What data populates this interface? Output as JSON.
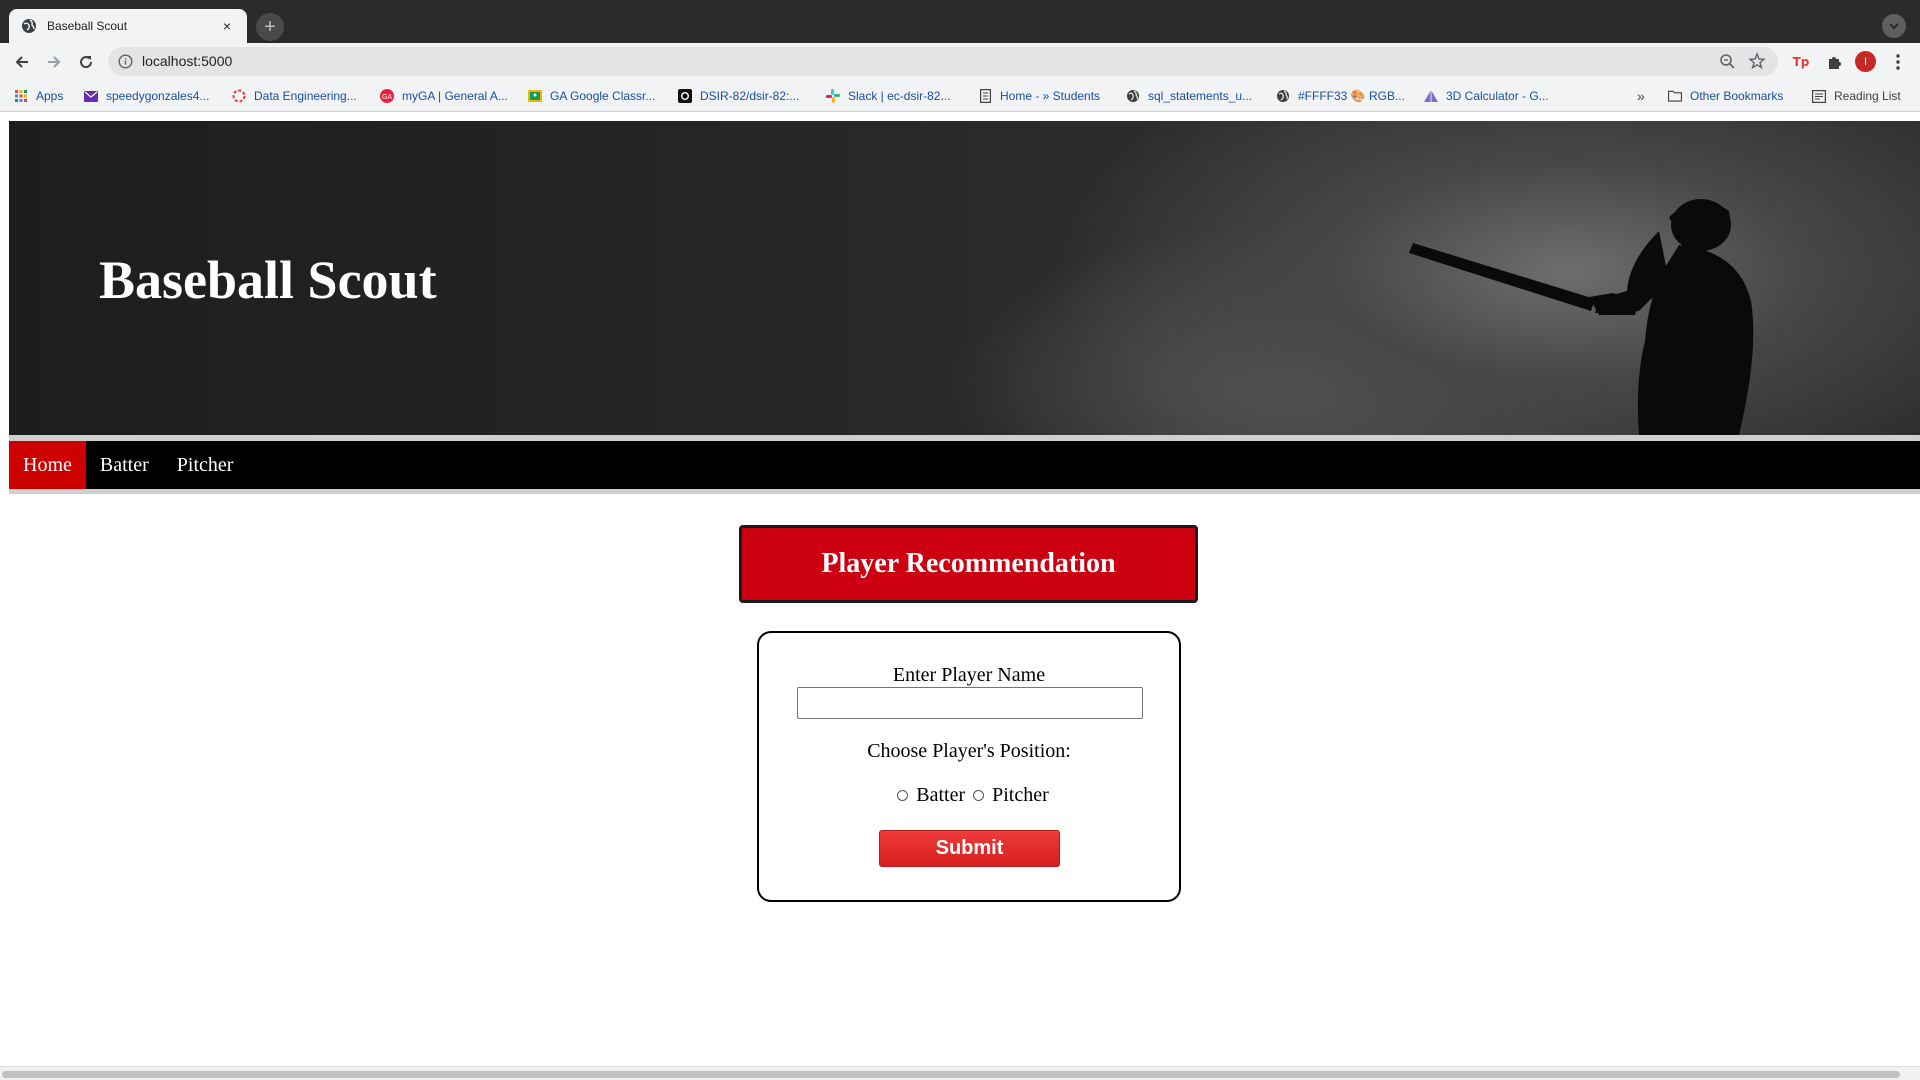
{
  "browser": {
    "tab_title": "Baseball Scout",
    "tab_close": "×",
    "new_tab": "+",
    "url": "localhost:5000",
    "profile_initial": "I",
    "ext_tp": "Tp",
    "bookmarks": [
      {
        "label": "Apps",
        "icon": "apps-grid-icon"
      },
      {
        "label": "speedygonzales4...",
        "icon": "mail-icon"
      },
      {
        "label": "Data Engineering...",
        "icon": "circle-icon"
      },
      {
        "label": "myGA | General A...",
        "icon": "ga-icon"
      },
      {
        "label": "GA Google Classr...",
        "icon": "classroom-icon"
      },
      {
        "label": "DSIR-82/dsir-82:...",
        "icon": "github-icon"
      },
      {
        "label": "Slack | ec-dsir-82...",
        "icon": "slack-icon"
      },
      {
        "label": "Home - » Students",
        "icon": "page-icon"
      },
      {
        "label": "sql_statements_u...",
        "icon": "globe-icon"
      },
      {
        "label": "#FFFF33 🎨 RGB...",
        "icon": "globe-icon"
      },
      {
        "label": "3D Calculator - G...",
        "icon": "geogebra-icon"
      }
    ],
    "more_bookmarks": "»",
    "other_bookmarks": "Other Bookmarks",
    "reading_list": "Reading List"
  },
  "page": {
    "hero_title": "Baseball Scout",
    "nav": [
      {
        "label": "Home",
        "active": true
      },
      {
        "label": "Batter",
        "active": false
      },
      {
        "label": "Pitcher",
        "active": false
      }
    ],
    "recommendation_title": "Player Recommendation",
    "form": {
      "player_name_label": "Enter Player Name",
      "player_name_value": "",
      "position_label": "Choose Player's Position:",
      "options": [
        "Batter",
        "Pitcher"
      ],
      "submit_label": "Submit"
    }
  },
  "colors": {
    "accent_red": "#cc0010",
    "nav_bg": "#000000",
    "nav_active": "#cc0000"
  }
}
